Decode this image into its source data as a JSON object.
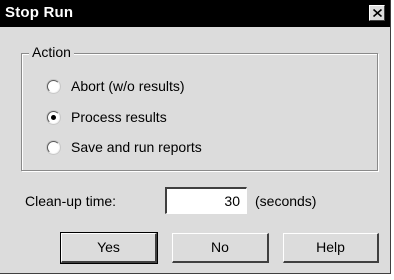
{
  "window": {
    "title": "Stop Run",
    "close_icon": "close-icon"
  },
  "action_group": {
    "legend": "Action",
    "options": [
      {
        "label": "Abort (w/o results)",
        "selected": false
      },
      {
        "label": "Process results",
        "selected": true
      },
      {
        "label": "Save and run reports",
        "selected": false
      }
    ]
  },
  "cleanup": {
    "label": "Clean-up time:",
    "value": "30",
    "unit": "(seconds)"
  },
  "buttons": {
    "yes": "Yes",
    "no": "No",
    "help": "Help"
  },
  "colors": {
    "titlebar": "#000000",
    "dialog_bg": "#dcdcdc"
  }
}
